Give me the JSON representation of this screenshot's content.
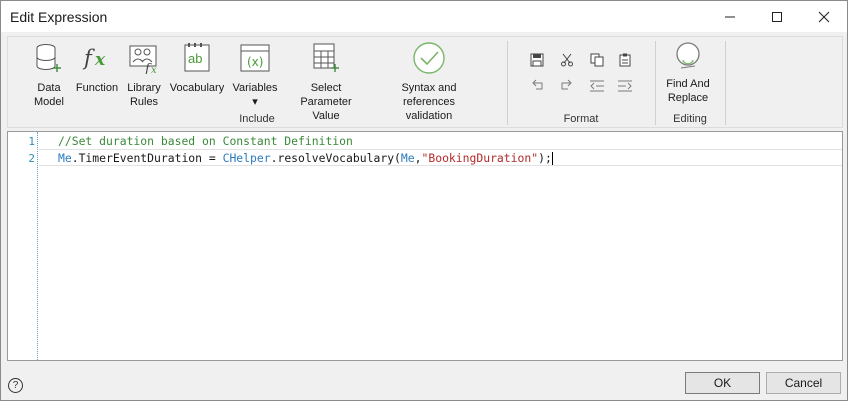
{
  "window": {
    "title": "Edit Expression",
    "controls": [
      "minimize-icon",
      "maximize-icon",
      "close-icon"
    ]
  },
  "ribbon": {
    "include": {
      "label": "Include",
      "buttons": [
        {
          "label": "Data\nModel",
          "icon": "database-plus-icon"
        },
        {
          "label": "Function",
          "icon": "function-fx-icon"
        },
        {
          "label": "Library\nRules",
          "icon": "library-rules-icon"
        },
        {
          "label": "Vocabulary",
          "icon": "vocabulary-ab-icon"
        },
        {
          "label": "Variables\n▾",
          "icon": "variables-x-icon"
        },
        {
          "label": "Select Parameter\nValue",
          "icon": "table-add-icon"
        },
        {
          "label": "Syntax and references\nvalidation",
          "icon": "check-circle-icon"
        }
      ]
    },
    "format": {
      "label": "Format",
      "buttons": [
        "save-icon",
        "cut-icon",
        "copy-icon",
        "paste-icon",
        "undo-icon",
        "redo-icon",
        "outdent-icon",
        "indent-icon"
      ]
    },
    "editing": {
      "label": "Editing",
      "buttons": [
        {
          "label": "Find And\nReplace",
          "icon": "find-replace-icon"
        }
      ]
    }
  },
  "editor": {
    "line_numbers": [
      "1",
      "2"
    ],
    "lines": [
      [
        {
          "t": "//Set duration based on Constant Definition",
          "c": "comment"
        }
      ],
      [
        {
          "t": "Me",
          "c": "kw"
        },
        {
          "t": ".TimerEventDuration = ",
          "c": "plain"
        },
        {
          "t": "CHelper",
          "c": "type"
        },
        {
          "t": ".resolveVocabulary(",
          "c": "plain"
        },
        {
          "t": "Me",
          "c": "kw"
        },
        {
          "t": ",",
          "c": "plain"
        },
        {
          "t": "\"BookingDuration\"",
          "c": "str"
        },
        {
          "t": ");",
          "c": "plain"
        }
      ]
    ]
  },
  "footer": {
    "help": "?",
    "ok": "OK",
    "cancel": "Cancel"
  }
}
